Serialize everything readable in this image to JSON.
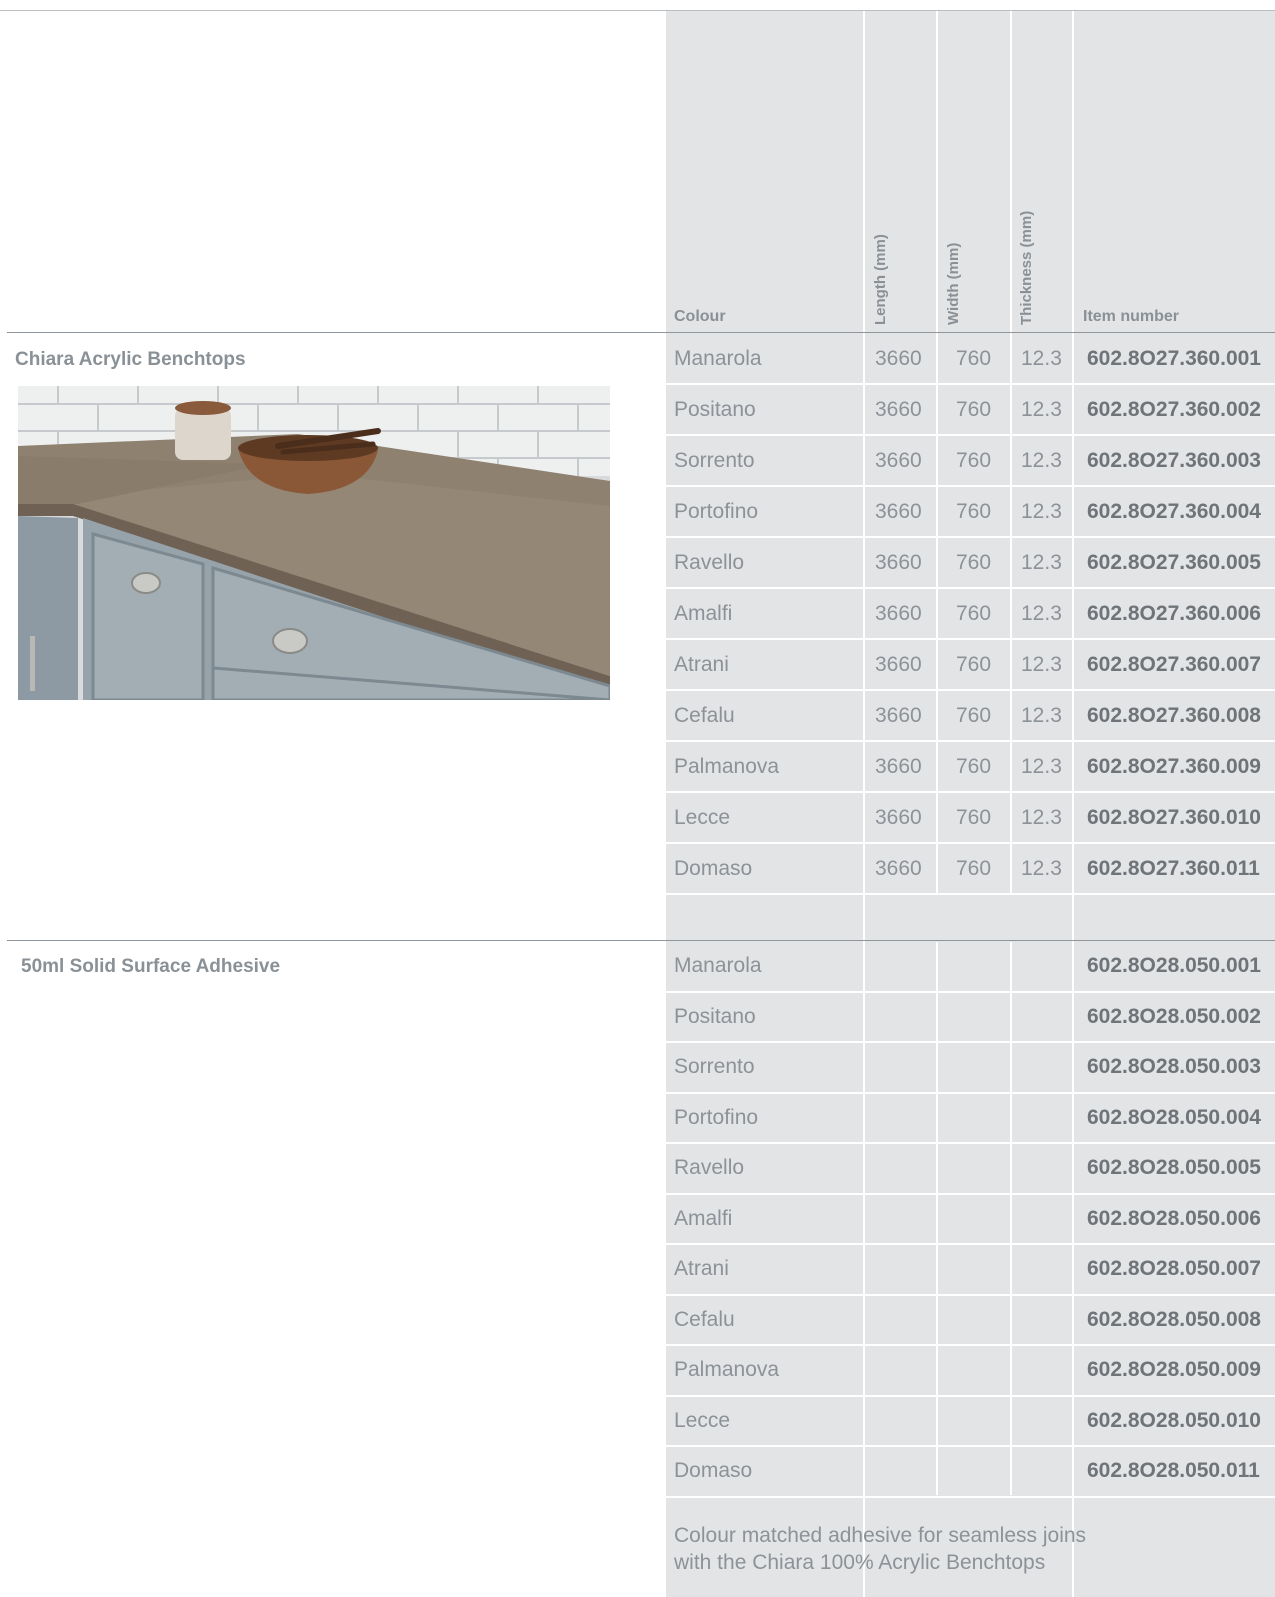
{
  "header": {
    "colour": "Colour",
    "length": "Length (mm)",
    "width": "Width (mm)",
    "thickness": "Thickness (mm)",
    "item_number": "Item number"
  },
  "sections": [
    {
      "title": "Chiara Acrylic Benchtops",
      "rows": [
        {
          "colour": "Manarola",
          "length": "3660",
          "width": "760",
          "thickness": "12.3",
          "item": "602.8O27.360.001"
        },
        {
          "colour": "Positano",
          "length": "3660",
          "width": "760",
          "thickness": "12.3",
          "item": "602.8O27.360.002"
        },
        {
          "colour": "Sorrento",
          "length": "3660",
          "width": "760",
          "thickness": "12.3",
          "item": "602.8O27.360.003"
        },
        {
          "colour": "Portofino",
          "length": "3660",
          "width": "760",
          "thickness": "12.3",
          "item": "602.8O27.360.004"
        },
        {
          "colour": "Ravello",
          "length": "3660",
          "width": "760",
          "thickness": "12.3",
          "item": "602.8O27.360.005"
        },
        {
          "colour": "Amalfi",
          "length": "3660",
          "width": "760",
          "thickness": "12.3",
          "item": "602.8O27.360.006"
        },
        {
          "colour": "Atrani",
          "length": "3660",
          "width": "760",
          "thickness": "12.3",
          "item": "602.8O27.360.007"
        },
        {
          "colour": "Cefalu",
          "length": "3660",
          "width": "760",
          "thickness": "12.3",
          "item": "602.8O27.360.008"
        },
        {
          "colour": "Palmanova",
          "length": "3660",
          "width": "760",
          "thickness": "12.3",
          "item": "602.8O27.360.009"
        },
        {
          "colour": "Lecce",
          "length": "3660",
          "width": "760",
          "thickness": "12.3",
          "item": "602.8O27.360.010"
        },
        {
          "colour": "Domaso",
          "length": "3660",
          "width": "760",
          "thickness": "12.3",
          "item": "602.8O27.360.011"
        }
      ]
    },
    {
      "title": "50ml Solid Surface Adhesive",
      "rows": [
        {
          "colour": "Manarola",
          "item": "602.8O28.050.001"
        },
        {
          "colour": "Positano",
          "item": "602.8O28.050.002"
        },
        {
          "colour": "Sorrento",
          "item": "602.8O28.050.003"
        },
        {
          "colour": "Portofino",
          "item": "602.8O28.050.004"
        },
        {
          "colour": "Ravello",
          "item": "602.8O28.050.005"
        },
        {
          "colour": "Amalfi",
          "item": "602.8O28.050.006"
        },
        {
          "colour": "Atrani",
          "item": "602.8O28.050.007"
        },
        {
          "colour": "Cefalu",
          "item": "602.8O28.050.008"
        },
        {
          "colour": "Palmanova",
          "item": "602.8O28.050.009"
        },
        {
          "colour": "Lecce",
          "item": "602.8O28.050.010"
        },
        {
          "colour": "Domaso",
          "item": "602.8O28.050.011"
        }
      ],
      "note_line1": "Colour matched adhesive for seamless joins",
      "note_line2": "with the Chiara 100% Acrylic Benchtops"
    }
  ],
  "colors": {
    "panel": "#e3e4e6",
    "text_light": "#8c9297",
    "text_bold": "#6f7478",
    "benchtop": "#8f8170",
    "cabinet": "#8e9aa3"
  },
  "image": {
    "subject": "kitchen-benchtop-photo"
  }
}
